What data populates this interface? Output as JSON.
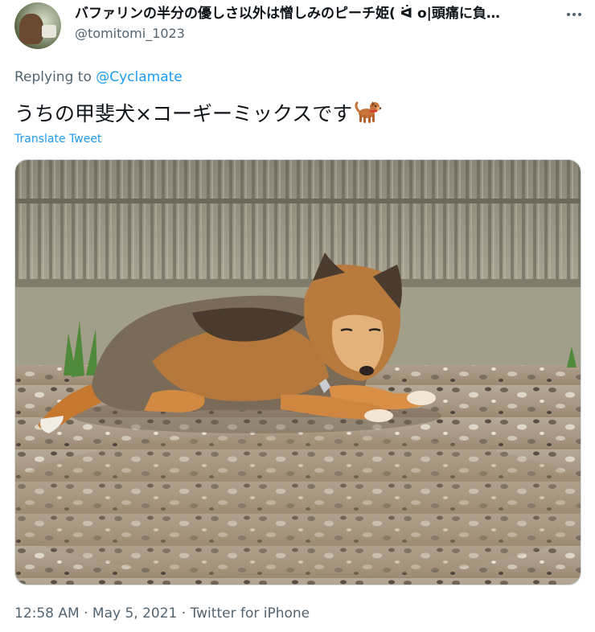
{
  "author": {
    "display_name": "バファリンの半分の優しさ以外は憎しみのピーチ姫( ᐛ o|頭痛に負…",
    "username": "@tomitomi_1023"
  },
  "reply": {
    "prefix": "Replying to ",
    "mention": "@Cyclamate"
  },
  "tweet": {
    "text": "うちの甲斐犬×コーギーミックスです",
    "emoji": "dog-emoji",
    "translate_label": "Translate Tweet"
  },
  "media": {
    "alt": "dog-photo"
  },
  "meta": {
    "time": "12:58 AM",
    "separator1": " · ",
    "date": "May 5, 2021",
    "separator2": " · ",
    "source": "Twitter for iPhone"
  },
  "colors": {
    "accent": "#1d9bf0",
    "secondary_text": "#536471",
    "primary_text": "#0f1419"
  },
  "icons": [
    "more-icon",
    "dog-emoji-icon"
  ]
}
